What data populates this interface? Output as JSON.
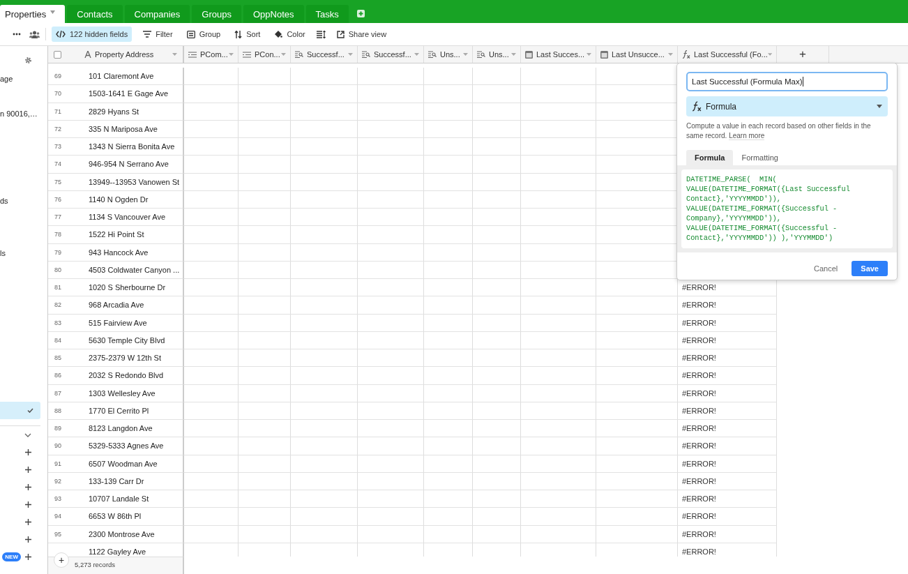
{
  "tabs": [
    {
      "label": "Properties",
      "selected": true
    },
    {
      "label": "Contacts",
      "selected": false
    },
    {
      "label": "Companies",
      "selected": false
    },
    {
      "label": "Groups",
      "selected": false
    },
    {
      "label": "OppNotes",
      "selected": false
    },
    {
      "label": "Tasks",
      "selected": false
    }
  ],
  "toolbar": [
    {
      "kind": "more"
    },
    {
      "kind": "people"
    },
    {
      "kind": "divider"
    },
    {
      "kind": "hidden",
      "label": "122 hidden fields",
      "selected": true
    },
    {
      "kind": "filter",
      "label": "Filter"
    },
    {
      "kind": "group",
      "label": "Group"
    },
    {
      "kind": "sort",
      "label": "Sort"
    },
    {
      "kind": "color",
      "label": "Color"
    },
    {
      "kind": "rowheight"
    },
    {
      "kind": "share",
      "label": "Share view"
    }
  ],
  "sidebar": {
    "items": [
      {
        "kind": "item",
        "text": "age"
      },
      {
        "kind": "spacer"
      },
      {
        "kind": "item",
        "text": "n 90016,…"
      },
      {
        "kind": "spacer"
      },
      {
        "kind": "spacer"
      },
      {
        "kind": "spacer"
      },
      {
        "kind": "spacer"
      },
      {
        "kind": "item",
        "text": "ds"
      },
      {
        "kind": "spacer"
      },
      {
        "kind": "spacer"
      },
      {
        "kind": "item",
        "text": "ls"
      }
    ],
    "lower": [
      {
        "kind": "view",
        "selected": true
      },
      {
        "kind": "divider"
      },
      {
        "kind": "collapse"
      },
      {
        "kind": "add"
      },
      {
        "kind": "add"
      },
      {
        "kind": "add"
      },
      {
        "kind": "add"
      },
      {
        "kind": "add"
      },
      {
        "kind": "add"
      },
      {
        "kind": "add",
        "badge": "NEW"
      }
    ]
  },
  "table": {
    "select_all": {
      "checked": false
    },
    "primary": {
      "label": "Property Address",
      "kind": "text"
    },
    "columns": [
      {
        "label": "PCom...",
        "kind": "rollup"
      },
      {
        "label": "PCon...",
        "kind": "rollup"
      },
      {
        "label": "Successf...",
        "kind": "lookup"
      },
      {
        "label": "Successf...",
        "kind": "lookup"
      },
      {
        "label": "Uns...",
        "kind": "lookup"
      },
      {
        "label": "Uns...",
        "kind": "lookup"
      },
      {
        "label": "Last Succes...",
        "kind": "date"
      },
      {
        "label": "Last Unsucce...",
        "kind": "date"
      },
      {
        "label": "Last Successful (Fo...",
        "kind": "formula"
      }
    ],
    "add_column": "+",
    "rows": [
      {
        "number": "69",
        "address": "101 Claremont Ave"
      },
      {
        "number": "70",
        "address": "1503-1641 E Gage Ave"
      },
      {
        "number": "71",
        "address": "2829 Hyans St"
      },
      {
        "number": "72",
        "address": "335 N Mariposa Ave"
      },
      {
        "number": "73",
        "address": "1343 N Sierra Bonita Ave"
      },
      {
        "number": "74",
        "address": "946-954 N Serrano Ave"
      },
      {
        "number": "75",
        "address": "13949--13953 Vanowen St"
      },
      {
        "number": "76",
        "address": "1140 N Ogden Dr"
      },
      {
        "number": "77",
        "address": "1134 S Vancouver Ave"
      },
      {
        "number": "78",
        "address": "1522 Hi Point St"
      },
      {
        "number": "79",
        "address": "943 Hancock Ave"
      },
      {
        "number": "80",
        "address": "4503 Coldwater Canyon ..."
      },
      {
        "number": "81",
        "address": "1020 S Sherbourne Dr",
        "last_successful": "#ERROR!"
      },
      {
        "number": "82",
        "address": "968 Arcadia Ave",
        "last_successful": "#ERROR!"
      },
      {
        "number": "83",
        "address": "515 Fairview Ave",
        "last_successful": "#ERROR!"
      },
      {
        "number": "84",
        "address": "5630 Temple City Blvd",
        "last_successful": "#ERROR!"
      },
      {
        "number": "85",
        "address": "2375-2379 W 12th St",
        "last_successful": "#ERROR!"
      },
      {
        "number": "86",
        "address": "2032 S Redondo Blvd",
        "last_successful": "#ERROR!"
      },
      {
        "number": "87",
        "address": "1303 Wellesley Ave",
        "last_successful": "#ERROR!"
      },
      {
        "number": "88",
        "address": "1770 El Cerrito Pl",
        "last_successful": "#ERROR!"
      },
      {
        "number": "89",
        "address": "8123 Langdon Ave",
        "last_successful": "#ERROR!"
      },
      {
        "number": "90",
        "address": "5329-5333 Agnes Ave",
        "last_successful": "#ERROR!"
      },
      {
        "number": "91",
        "address": "6507 Woodman Ave",
        "last_successful": "#ERROR!"
      },
      {
        "number": "92",
        "address": "133-139 Carr Dr",
        "last_successful": "#ERROR!"
      },
      {
        "number": "93",
        "address": "10707 Landale St",
        "last_successful": "#ERROR!"
      },
      {
        "number": "94",
        "address": "6653 W 86th Pl",
        "last_successful": "#ERROR!"
      },
      {
        "number": "95",
        "address": "2300 Montrose Ave",
        "last_successful": "#ERROR!"
      },
      {
        "address": "1122 Gayley Ave",
        "last_successful": "#ERROR!"
      }
    ],
    "footer": {
      "add": "+",
      "count": "5,273 records"
    }
  },
  "field_editor": {
    "name": "Last Successful (Formula Max)",
    "type": "Formula",
    "description": "Compute a value in each record based on other fields in the same record.",
    "learn_more": "Learn more",
    "tabs": [
      {
        "label": "Formula",
        "selected": true
      },
      {
        "label": "Formatting",
        "selected": false
      }
    ],
    "formula": "DATETIME_PARSE(  MIN(\nVALUE(DATETIME_FORMAT({Last Successful\nContact},'YYYYMMDD')),\nVALUE(DATETIME_FORMAT({Successful -\nCompany},'YYYYMMDD')),\nVALUE(DATETIME_FORMAT({Successful -\nContact},'YYYYMMDD')) ),'YYYMMDD')",
    "cancel": "Cancel",
    "save": "Save"
  }
}
